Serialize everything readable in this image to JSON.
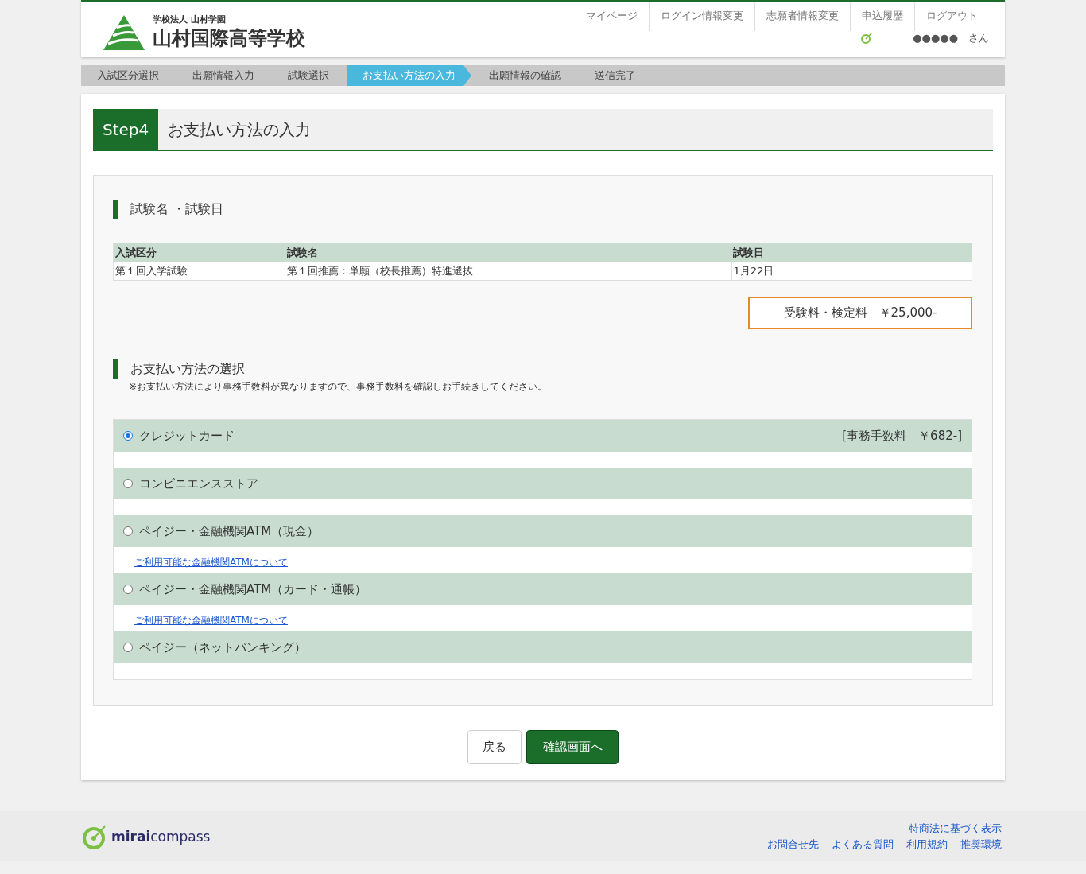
{
  "header": {
    "school_org": "学校法人 山村学園",
    "school_name": "山村国際高等学校",
    "nav": [
      "マイページ",
      "ログイン情報変更",
      "志願者情報変更",
      "申込履歴",
      "ログアウト"
    ],
    "user": "●●●●●　さん"
  },
  "steps": [
    {
      "label": "入試区分選択",
      "selected": false
    },
    {
      "label": "出願情報入力",
      "selected": false
    },
    {
      "label": "試験選択",
      "selected": false
    },
    {
      "label": "お支払い方法の入力",
      "selected": true
    },
    {
      "label": "出願情報の確認",
      "selected": false
    },
    {
      "label": "送信完了",
      "selected": false
    }
  ],
  "page": {
    "step_badge": "Step4",
    "title": "お支払い方法の入力"
  },
  "exam_section": {
    "heading": "試験名 ・試験日",
    "table": {
      "columns": [
        "入試区分",
        "試験名",
        "試験日"
      ],
      "rows": [
        [
          "第１回入学試験",
          "第１回推薦：単願（校長推薦）特進選抜",
          "1月22日"
        ]
      ]
    },
    "fee": "受験料・検定料　￥25,000-"
  },
  "payment_section": {
    "heading": "お支払い方法の選択",
    "note": "※お支払い方法により事務手数料が異なりますので、事務手数料を確認しお手続きしてください。",
    "options": [
      {
        "label": "クレジットカード",
        "selected": true,
        "fee": "[事務手数料　￥682-]"
      },
      {
        "label": "コンビニエンスストア",
        "selected": false
      },
      {
        "label": "ペイジー・金融機関ATM（現金）",
        "selected": false,
        "link": "ご利用可能な金融機関ATMについて"
      },
      {
        "label": "ペイジー・金融機関ATM（カード・通帳）",
        "selected": false,
        "link": "ご利用可能な金融機関ATMについて"
      },
      {
        "label": "ペイジー（ネットバンキング）",
        "selected": false
      }
    ]
  },
  "buttons": {
    "back": "戻る",
    "next": "確認画面へ"
  },
  "footer": {
    "logo": "**mirai**compass",
    "links_top": [
      "特商法に基づく表示"
    ],
    "links_bottom": [
      "お問合せ先",
      "よくある質問",
      "利用規約",
      "推奨環境"
    ]
  }
}
